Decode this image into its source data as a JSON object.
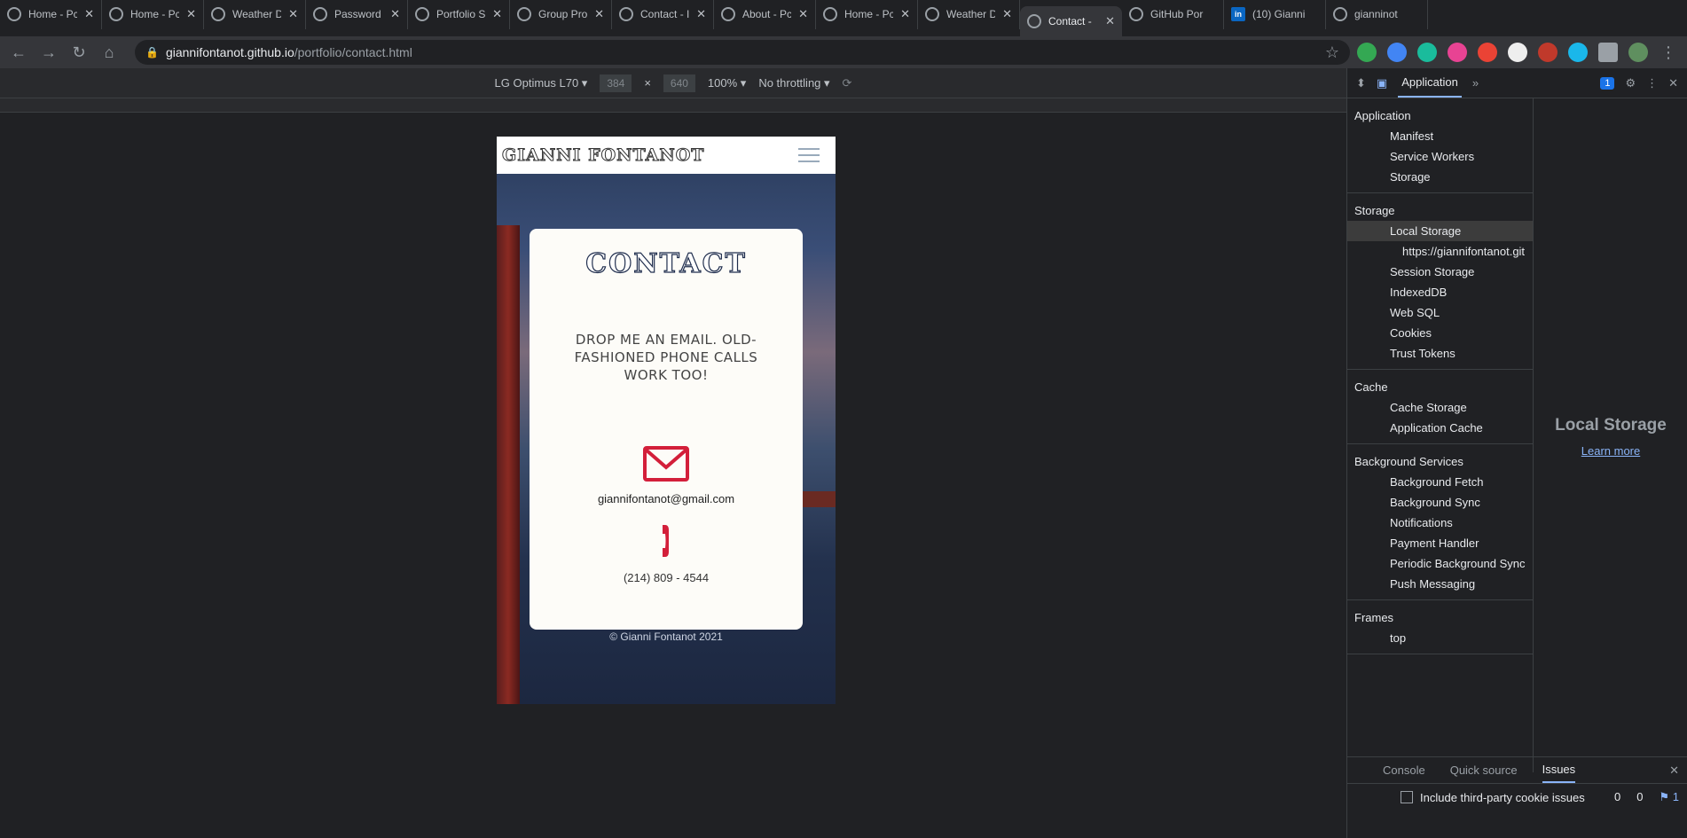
{
  "tabs": [
    {
      "title": "Home - Pc",
      "active": false
    },
    {
      "title": "Home - Pc",
      "active": false
    },
    {
      "title": "Weather D",
      "active": false
    },
    {
      "title": "Password G",
      "active": false
    },
    {
      "title": "Portfolio S",
      "active": false
    },
    {
      "title": "Group Pro",
      "active": false
    },
    {
      "title": "Contact - I",
      "active": false
    },
    {
      "title": "About - Pc",
      "active": false
    },
    {
      "title": "Home - Pc",
      "active": false
    },
    {
      "title": "Weather D",
      "active": false
    },
    {
      "title": "Contact -",
      "active": true
    },
    {
      "title": "GitHub Por",
      "active": false
    },
    {
      "title": "(10) Gianni",
      "active": false
    },
    {
      "title": "gianninot",
      "active": false
    }
  ],
  "address": {
    "host": "giannifontanot.github.io",
    "path": "/portfolio/contact.html"
  },
  "device_toolbar": {
    "device": "LG Optimus L70",
    "width": "384",
    "height": "640",
    "zoom": "100%",
    "throttle": "No throttling"
  },
  "site": {
    "logo": "GIANNI FONTANOT",
    "card_title": "CONTACT",
    "lead": "DROP ME AN EMAIL. OLD-FASHIONED PHONE CALLS WORK TOO!",
    "email": "giannifontanot@gmail.com",
    "phone": "(214) 809 - 4544",
    "copyright": "© Gianni Fontanot 2021",
    "accent": "#d31f3a"
  },
  "devtools": {
    "panel": "Application",
    "issues_badge": "1",
    "sections": [
      {
        "title": "Application",
        "items": [
          "Manifest",
          "Service Workers",
          "Storage"
        ]
      },
      {
        "title": "Storage",
        "items": [
          "Local Storage",
          "https://giannifontanot.git",
          "Session Storage",
          "IndexedDB",
          "Web SQL",
          "Cookies",
          "Trust Tokens"
        ]
      },
      {
        "title": "Cache",
        "items": [
          "Cache Storage",
          "Application Cache"
        ]
      },
      {
        "title": "Background Services",
        "items": [
          "Background Fetch",
          "Background Sync",
          "Notifications",
          "Payment Handler",
          "Periodic Background Sync",
          "Push Messaging"
        ]
      },
      {
        "title": "Frames",
        "items": [
          "top"
        ]
      }
    ],
    "main_heading": "Local Storage",
    "learn_more": "Learn more",
    "drawer_tabs": [
      "Console",
      "Quick source",
      "Issues"
    ],
    "checkbox_label": "Include third-party cookie issues",
    "counts": [
      "0",
      "0",
      "1"
    ]
  }
}
